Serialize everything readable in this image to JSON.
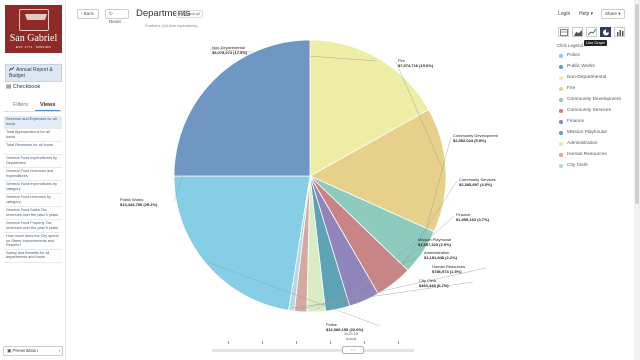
{
  "sidebar": {
    "logo_name": "San Gabriel",
    "logo_sub": "EST. 1771 · MISSION",
    "nav_active": "Annual Report & Budget",
    "nav_checkbook": "Checkbook",
    "tab_filters": "Filters",
    "tab_views": "Views",
    "views": [
      "Revenue and Expenses for all funds",
      "Total Appropriations for all funds",
      "Total Revenues for all funds",
      "General Fund expenditures by Department",
      "General Fund revenues and expenditures",
      "General Fund expenditures by category",
      "General Fund revenues by category",
      "General Fund Sales Tax revenues over the past 5 years",
      "General Fund Property Tax revenues over the past 5 years",
      "How much does the City spend on Street Improvements and Repairs?",
      "Salary and Benefits for all departments and funds"
    ],
    "presentation": "Presentation"
  },
  "toolbar": {
    "back": "‹ Back",
    "reset": "↻ Reset",
    "title": "Departments",
    "expand": "▾ Expand all",
    "subtitle": "Positions (full-time equivalents)",
    "login": "Login",
    "help": "Help ▾",
    "share": "Share ▾"
  },
  "chart_tooltip": "Line Graph",
  "legend_title": "Click Legend...",
  "legend": [
    {
      "label": "Police",
      "color": "#86cde6"
    },
    {
      "label": "Public Works",
      "color": "#6f97c4"
    },
    {
      "label": "Non-Departmental",
      "color": "#eeeda6"
    },
    {
      "label": "Fire",
      "color": "#e7d18a"
    },
    {
      "label": "Community Development",
      "color": "#8ccbbd"
    },
    {
      "label": "Community Services",
      "color": "#c98585"
    },
    {
      "label": "Finance",
      "color": "#9085ba"
    },
    {
      "label": "Mission Playhouse",
      "color": "#5ea2b6"
    },
    {
      "label": "Administration",
      "color": "#d9ecc4"
    },
    {
      "label": "Human Resources",
      "color": "#d4a9a1"
    },
    {
      "label": "City Clerk",
      "color": "#b2d8e6"
    }
  ],
  "chart_data": {
    "type": "pie",
    "units": "USD",
    "slices": [
      {
        "label": "Non-Departmental",
        "value": 9078074,
        "pct": 17.0,
        "value_text": "$9,078,074 (17.0%)",
        "color": "#eeeda6"
      },
      {
        "label": "Fire",
        "value": 7974716,
        "pct": 15.0,
        "value_text": "$7,974,716 (15.0%)",
        "color": "#e7d18a"
      },
      {
        "label": "Community Development",
        "value": 2952024,
        "pct": 5.5,
        "value_text": "$2,952,024 (5.5%)",
        "color": "#8ccbbd"
      },
      {
        "label": "Community Services",
        "value": 2385897,
        "pct": 4.5,
        "value_text": "$2,385,897 (4.5%)",
        "color": "#c98585"
      },
      {
        "label": "Finance",
        "value": 1955163,
        "pct": 3.7,
        "value_text": "$1,955,163 (3.7%)",
        "color": "#9085ba"
      },
      {
        "label": "Mission Playhouse",
        "value": 1557323,
        "pct": 2.9,
        "value_text": "$1,557,323 (2.9%)",
        "color": "#5ea2b6"
      },
      {
        "label": "Administration",
        "value": 1181848,
        "pct": 2.2,
        "value_text": "$1,181,848 (2.2%)",
        "color": "#d9ecc4"
      },
      {
        "label": "Human Resources",
        "value": 786974,
        "pct": 1.5,
        "value_text": "$786,974 (1.5%)",
        "color": "#d4a9a1"
      },
      {
        "label": "City Clerk",
        "value": 363448,
        "pct": 0.7,
        "value_text": "$363,448 (0.7%)",
        "color": "#b2d8e6"
      },
      {
        "label": "Police",
        "value": 12085155,
        "pct": 22.6,
        "value_text": "$12,085,155 (22.6%)",
        "color": "#86cde6"
      },
      {
        "label": "Public Works",
        "value": 13444750,
        "pct": 25.2,
        "value_text": "$13,444,750 (25.2%)",
        "color": "#6f97c4"
      }
    ]
  },
  "slider": {
    "year": "2015-16",
    "mode": "Actual",
    "thumb": "‹ ›"
  }
}
